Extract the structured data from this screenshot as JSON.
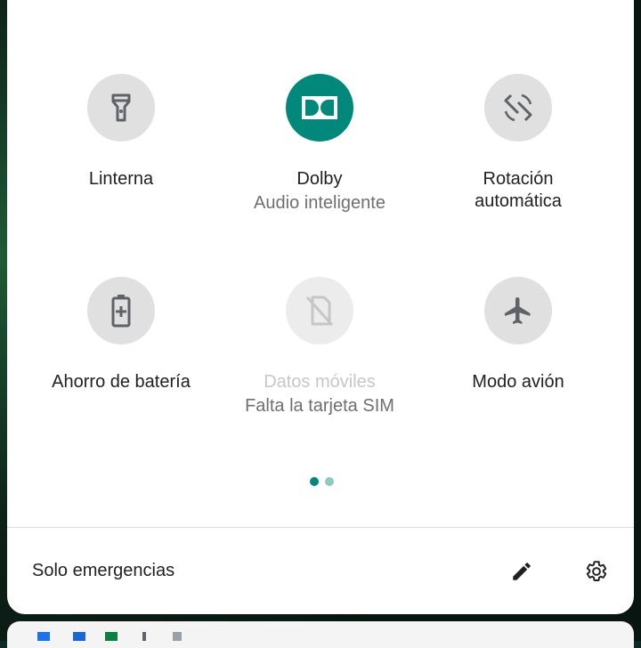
{
  "quick_settings": {
    "tiles": [
      {
        "label": "Linterna",
        "sublabel": "",
        "icon": "flashlight-icon",
        "state": "off"
      },
      {
        "label": "Dolby",
        "sublabel": "Audio inteligente",
        "icon": "dolby-icon",
        "state": "on"
      },
      {
        "label": "Rotación automática",
        "sublabel": "",
        "icon": "auto-rotate-icon",
        "state": "off"
      },
      {
        "label": "Ahorro de batería",
        "sublabel": "",
        "icon": "battery-saver-icon",
        "state": "off"
      },
      {
        "label": "Datos móviles",
        "sublabel": "Falta la tarjeta SIM",
        "icon": "no-sim-icon",
        "state": "disabled"
      },
      {
        "label": "Modo avión",
        "sublabel": "",
        "icon": "airplane-icon",
        "state": "off"
      }
    ],
    "page_indicator": {
      "pages": 2,
      "current": 1
    }
  },
  "footer": {
    "status_text": "Solo emergencias",
    "edit_icon": "pencil-icon",
    "settings_icon": "gear-icon"
  },
  "colors": {
    "accent": "#00897b",
    "tile_off": "#e0e0e0",
    "icon": "#5f6368"
  }
}
